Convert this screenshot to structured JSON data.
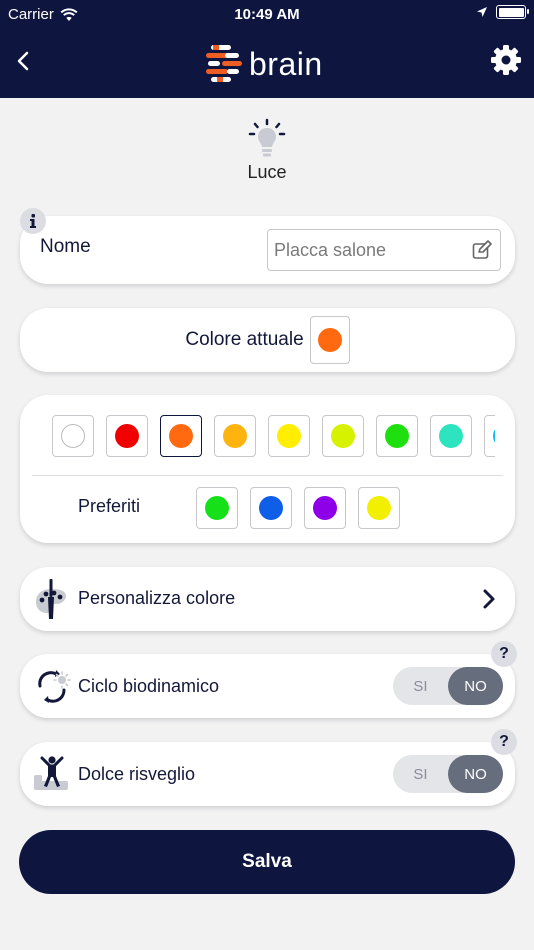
{
  "status_bar": {
    "carrier": "Carrier",
    "time": "10:49 AM"
  },
  "header": {
    "logo_text": "brain",
    "accent": "#ee5d24",
    "bar_color": "#0e1640"
  },
  "device": {
    "name": "Luce"
  },
  "name_field": {
    "label": "Nome",
    "placeholder": "Placca salone",
    "value": ""
  },
  "current_color": {
    "label": "Colore attuale",
    "color": "#ff6a10"
  },
  "palette": {
    "colors": [
      "#ffffff",
      "#f00000",
      "#ff6a10",
      "#ffb30e",
      "#ffee00",
      "#d7f200",
      "#1fe00e",
      "#2de3c0",
      "#12b6f0"
    ],
    "selected_index": 2
  },
  "favorites": {
    "label": "Preferiti",
    "colors": [
      "#16e018",
      "#0e5ee8",
      "#8e00e8",
      "#f2f000"
    ]
  },
  "customize": {
    "label": "Personalizza colore"
  },
  "biodynamic": {
    "label": "Ciclo biodinamico",
    "on_label": "SI",
    "off_label": "NO",
    "value": "NO"
  },
  "wakeup": {
    "label": "Dolce risveglio",
    "on_label": "SI",
    "off_label": "NO",
    "value": "NO"
  },
  "help_badge": "?",
  "save_button": {
    "label": "Salva"
  }
}
